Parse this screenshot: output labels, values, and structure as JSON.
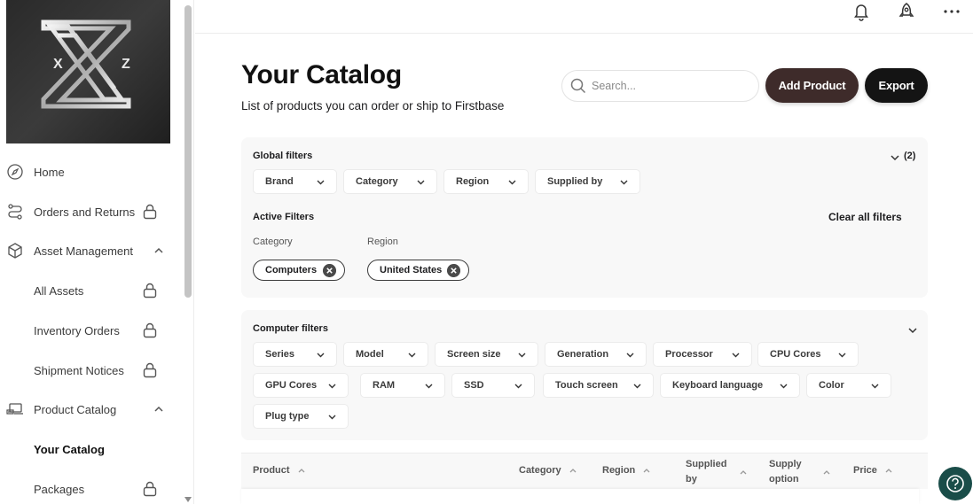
{
  "sidebar": {
    "logo_letters": [
      "X",
      "Z"
    ],
    "items": [
      {
        "label": "Home",
        "icon": "compass-icon",
        "locked": false
      },
      {
        "label": "Orders and Returns",
        "icon": "route-icon",
        "locked": true
      },
      {
        "label": "Asset Management",
        "icon": "box-icon",
        "expanded": true
      },
      {
        "label": "All Assets",
        "locked": true
      },
      {
        "label": "Inventory Orders",
        "locked": true
      },
      {
        "label": "Shipment Notices",
        "locked": true
      },
      {
        "label": "Product Catalog",
        "icon": "laptop-icon",
        "expanded": true
      },
      {
        "label": "Your Catalog",
        "active": true
      },
      {
        "label": "Packages",
        "locked": true
      }
    ]
  },
  "topbar": {
    "icons": [
      "bell-icon",
      "rocket-icon",
      "more-icon"
    ]
  },
  "header": {
    "title": "Your Catalog",
    "subtitle": "List of products you can order or ship to Firstbase",
    "search_placeholder": "Search...",
    "add_product_label": "Add Product",
    "export_label": "Export"
  },
  "global_filters": {
    "title": "Global filters",
    "count": "(2)",
    "dropdowns": [
      "Brand",
      "Category",
      "Region",
      "Supplied by"
    ],
    "active_title": "Active Filters",
    "clear_all_label": "Clear all filters",
    "groups": [
      {
        "label": "Category",
        "chips": [
          "Computers"
        ]
      },
      {
        "label": "Region",
        "chips": [
          "United States"
        ]
      }
    ]
  },
  "computer_filters": {
    "title": "Computer filters",
    "rows": [
      [
        "Series",
        "Model",
        "Screen size",
        "Generation",
        "Processor",
        "CPU Cores"
      ],
      [
        "GPU Cores",
        "RAM",
        "SSD",
        "Touch screen",
        "Keyboard language",
        "Color"
      ],
      [
        "Plug type"
      ]
    ]
  },
  "table": {
    "columns": [
      "Product",
      "Category",
      "Region",
      "Supplied by",
      "Supply option",
      "Price"
    ]
  },
  "colors": {
    "add_button": "#3e2b2a",
    "export_button": "#141414",
    "help_button": "#1a4d49",
    "panel_bg": "#f8f8f8"
  }
}
